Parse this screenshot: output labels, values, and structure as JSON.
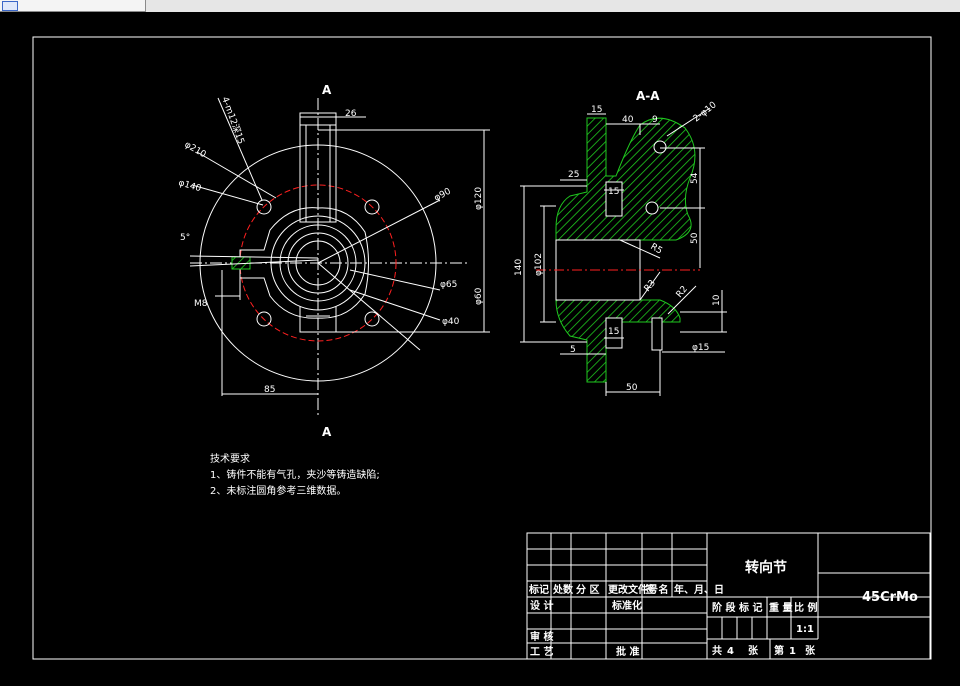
{
  "drawing": {
    "section_label_top": "A",
    "section_label_bottom": "A",
    "section_view_title": "A-A",
    "front_dims": {
      "d26": "26",
      "d_4m": "4-m12深15",
      "d210": "φ210",
      "d140": "φ140",
      "d5deg": "5°",
      "d_m8": "M8",
      "d85": "85",
      "d90": "φ90",
      "d120": "φ120",
      "d65": "φ65",
      "d60": "φ60",
      "d40": "φ40"
    },
    "section_dims": {
      "d15a": "15",
      "d40": "40",
      "d9": "9",
      "d2phi": "2-φ10",
      "d25": "25",
      "d15b": "15",
      "d54": "54",
      "d50v": "50",
      "dR5": "R5",
      "d140v": "140",
      "d102": "φ102",
      "dR3": "R3",
      "dR2": "R2",
      "d10": "10",
      "d15c": "15",
      "d5": "5",
      "d15d": "φ15",
      "d50h": "50"
    }
  },
  "notes": {
    "title": "技术要求",
    "line1": "1、铸件不能有气孔，夹沙等铸造缺陷;",
    "line2": "2、未标注圆角参考三维数据。"
  },
  "title_block": {
    "part_name": "转向节",
    "material": "45CrMo",
    "h_mark": "标记",
    "h_count": "处数",
    "h_zone": "分 区",
    "h_docno": "更改文件号",
    "h_sign": "签 名",
    "h_date": "年、月、日",
    "design": "设 计",
    "standard": "标准化",
    "check": "审 核",
    "process": "工 艺",
    "approve": "批 准",
    "stage": "阶 段 标 记",
    "weight": "重 量",
    "scale": "比 例",
    "scale_val": "1:1",
    "sheets_total_lbl": "共",
    "sheets_total": "4",
    "zhang1": "张",
    "di": "第",
    "sheet_no": "1",
    "zhang2": "张"
  },
  "colors": {
    "line": "#ffffff",
    "center": "#ff2020",
    "hatch": "#1fc81f",
    "background": "#000000"
  }
}
